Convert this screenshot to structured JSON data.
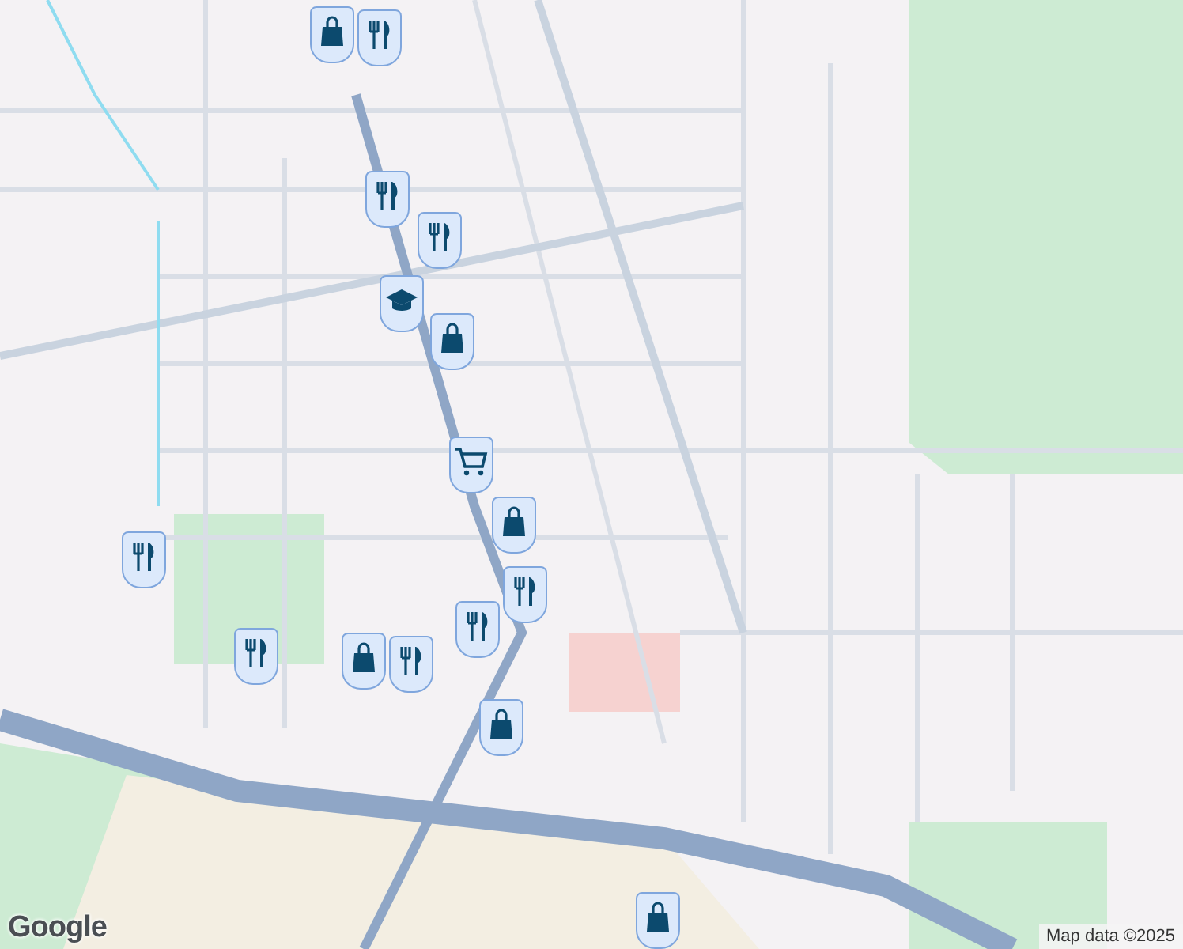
{
  "map": {
    "pins": [
      {
        "kind": "shopping"
      },
      {
        "kind": "restaurant"
      },
      {
        "kind": "restaurant"
      },
      {
        "kind": "restaurant"
      },
      {
        "kind": "school"
      },
      {
        "kind": "shopping"
      },
      {
        "kind": "cart"
      },
      {
        "kind": "shopping"
      },
      {
        "kind": "restaurant"
      },
      {
        "kind": "restaurant"
      },
      {
        "kind": "restaurant"
      },
      {
        "kind": "restaurant"
      },
      {
        "kind": "shopping"
      },
      {
        "kind": "restaurant"
      },
      {
        "kind": "shopping"
      },
      {
        "kind": "shopping"
      }
    ]
  },
  "logo": "Google",
  "attribution": "Map data ©2025"
}
